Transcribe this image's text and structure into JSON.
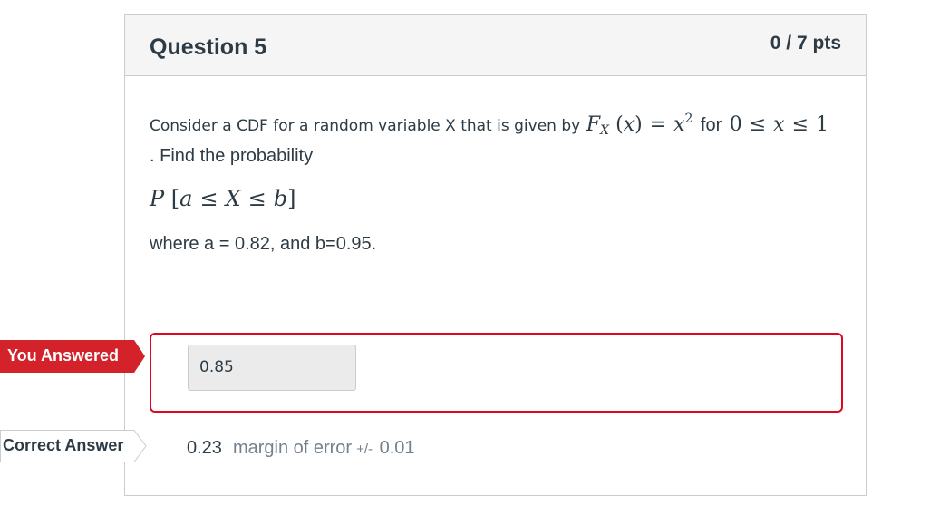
{
  "question": {
    "title": "Question 5",
    "points": "0 / 7 pts",
    "intro": "Consider a CDF for a random variable X that is given by",
    "for_word": "for",
    "line2": ". Find the probability",
    "where": "where a = 0.82, and b=0.95."
  },
  "answer": {
    "you_answered_label": "You Answered",
    "value": "0.85",
    "correct_label": "Correct Answer",
    "correct_value": "0.23",
    "margin_text": "margin of error",
    "margin_pm": "+/-",
    "margin_value": "0.01",
    "error_color": "#e0061f",
    "tag_color": "#d3222a"
  }
}
